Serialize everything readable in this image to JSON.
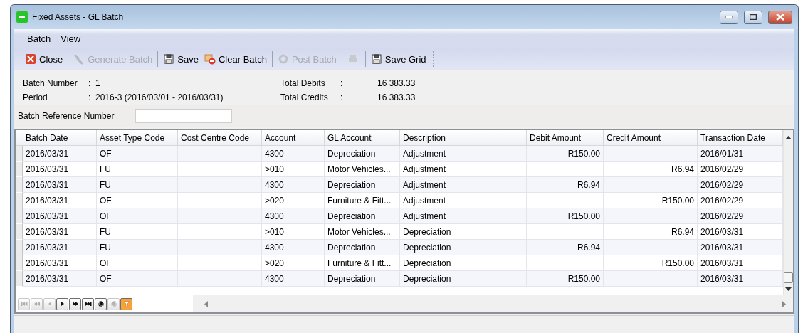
{
  "window": {
    "title": "Fixed Assets - GL Batch"
  },
  "menu": [
    {
      "label": "Batch"
    },
    {
      "label": "View"
    }
  ],
  "toolbar": [
    {
      "kind": "button",
      "label": "Close",
      "disabled": false
    },
    {
      "kind": "separator"
    },
    {
      "kind": "button",
      "label": "Generate Batch",
      "disabled": true
    },
    {
      "kind": "separator"
    },
    {
      "kind": "button",
      "label": "Save",
      "disabled": false
    },
    {
      "kind": "button",
      "label": "Clear Batch",
      "disabled": false
    },
    {
      "kind": "separator"
    },
    {
      "kind": "button",
      "label": "Post Batch",
      "disabled": true
    },
    {
      "kind": "separator"
    },
    {
      "kind": "icon_button",
      "disabled": true
    },
    {
      "kind": "separator"
    },
    {
      "kind": "button",
      "label": "Save Grid",
      "disabled": false
    }
  ],
  "summary_left": [
    {
      "label": "Batch Number",
      "separator": ":",
      "value": "1"
    },
    {
      "label": "Period",
      "separator": ":",
      "value": "2016-3  (2016/03/01 - 2016/03/31)"
    }
  ],
  "summary_right": [
    {
      "label": "Total Debits",
      "separator": ":",
      "value": "16 383.33"
    },
    {
      "label": "Total Credits",
      "separator": ":",
      "value": "16 383.33"
    }
  ],
  "batch_reference": {
    "label": "Batch Reference Number"
  },
  "table": {
    "columns": [
      {
        "label": "Batch Date"
      },
      {
        "label": "Asset Type Code"
      },
      {
        "label": "Cost Centre Code"
      },
      {
        "label": "Account"
      },
      {
        "label": "GL Account"
      },
      {
        "label": "Description"
      },
      {
        "label": "Debit Amount"
      },
      {
        "label": "Credit Amount"
      },
      {
        "label": "Transaction Date"
      }
    ],
    "rows": [
      [
        "2016/03/31",
        "OF",
        "",
        "4300",
        "Depreciation",
        "Adjustment",
        "R150.00",
        "",
        "2016/01/31"
      ],
      [
        "2016/03/31",
        "FU",
        "",
        ">010",
        "Motor Vehicles...",
        "Adjustment",
        "",
        "R6.94",
        "2016/02/29"
      ],
      [
        "2016/03/31",
        "FU",
        "",
        "4300",
        "Depreciation",
        "Adjustment",
        "R6.94",
        "",
        "2016/02/29"
      ],
      [
        "2016/03/31",
        "OF",
        "",
        ">020",
        "Furniture & Fitt...",
        "Adjustment",
        "",
        "R150.00",
        "2016/02/29"
      ],
      [
        "2016/03/31",
        "OF",
        "",
        "4300",
        "Depreciation",
        "Adjustment",
        "R150.00",
        "",
        "2016/02/29"
      ],
      [
        "2016/03/31",
        "FU",
        "",
        ">010",
        "Motor Vehicles...",
        "Depreciation",
        "",
        "R6.94",
        "2016/03/31"
      ],
      [
        "2016/03/31",
        "FU",
        "",
        "4300",
        "Depreciation",
        "Depreciation",
        "R6.94",
        "",
        "2016/03/31"
      ],
      [
        "2016/03/31",
        "OF",
        "",
        ">020",
        "Furniture & Fitt...",
        "Depreciation",
        "",
        "R150.00",
        "2016/03/31"
      ],
      [
        "2016/03/31",
        "OF",
        "",
        "4300",
        "Depreciation",
        "Depreciation",
        "R150.00",
        "",
        "2016/03/31"
      ]
    ]
  },
  "navigator": [
    {
      "disabled": true
    },
    {
      "disabled": true
    },
    {
      "disabled": true
    },
    {
      "disabled": false
    },
    {
      "disabled": false
    },
    {
      "disabled": false
    },
    {
      "disabled": false
    },
    {
      "disabled": true
    },
    {
      "disabled": false
    }
  ]
}
